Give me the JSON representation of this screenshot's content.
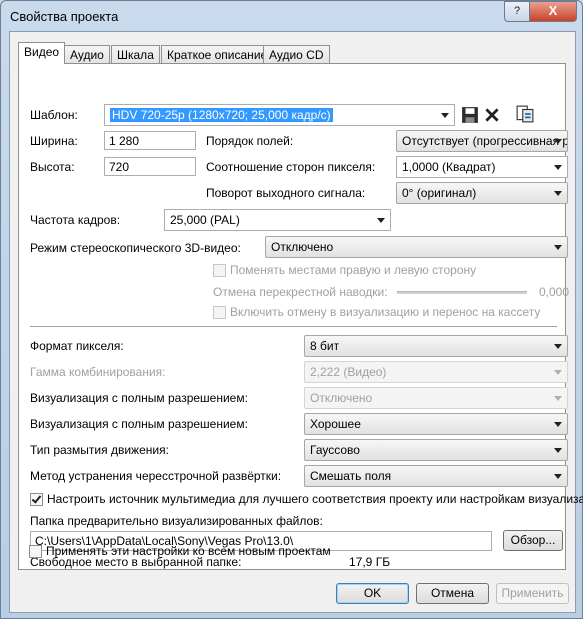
{
  "window": {
    "title": "Свойства проекта"
  },
  "titlebar": {
    "help": "?",
    "close": "X"
  },
  "tabs": [
    "Видео",
    "Аудио",
    "Шкала",
    "Краткое описание",
    "Аудио CD"
  ],
  "template": {
    "label": "Шаблон:",
    "value": "HDV 720-25p (1280x720; 25,000 кадр/с)"
  },
  "width": {
    "label": "Ширина:",
    "value": "1 280"
  },
  "height": {
    "label": "Высота:",
    "value": "720"
  },
  "field_order": {
    "label": "Порядок полей:",
    "value": "Отсутствует (прогрессивная р"
  },
  "pixel_aspect": {
    "label": "Соотношение сторон пикселя:",
    "value": "1,0000 (Квадрат)"
  },
  "rotation": {
    "label": "Поворот выходного сигнала:",
    "value": "0° (оригинал)"
  },
  "frame_rate": {
    "label": "Частота кадров:",
    "value": "25,000 (PAL)"
  },
  "stereo3d": {
    "label": "Режим стереоскопического 3D-видео:",
    "value": "Отключено",
    "swap_label": "Поменять местами правую и левую сторону",
    "crosstalk_label": "Отмена перекрестной наводки:",
    "crosstalk_value": "0,000",
    "enable_label": "Включить отмену в визуализацию и перенос на кассету"
  },
  "pixel_format": {
    "label": "Формат пикселя:",
    "value": "8 бит"
  },
  "gamma": {
    "label": "Гамма комбинирования:",
    "value": "2,222 (Видео)"
  },
  "full_res_1": {
    "label": "Визуализация с полным разрешением:",
    "value": "Отключено"
  },
  "full_res_2": {
    "label": "Визуализация с полным разрешением:",
    "value": "Хорошее"
  },
  "motion_blur": {
    "label": "Тип размытия движения:",
    "value": "Гауссово"
  },
  "deinterlace": {
    "label": "Метод устранения чересстрочной развёртки:",
    "value": "Смешать поля"
  },
  "adjust_source": {
    "label": "Настроить источник мультимедиа для лучшего соответствия проекту или настройкам визуализации",
    "checked": true
  },
  "prerender": {
    "label": "Папка предварительно визуализированных файлов:",
    "path": "C:\\Users\\1\\AppData\\Local\\Sony\\Vegas Pro\\13.0\\",
    "browse": "Обзор..."
  },
  "free_space": {
    "label": "Свободное место в выбранной папке:",
    "value": "17,9 ГБ"
  },
  "apply_all": {
    "label": "Применять эти настройки ко всем новым проектам",
    "checked": false
  },
  "footer": {
    "ok": "OK",
    "cancel": "Отмена",
    "apply": "Применить"
  }
}
